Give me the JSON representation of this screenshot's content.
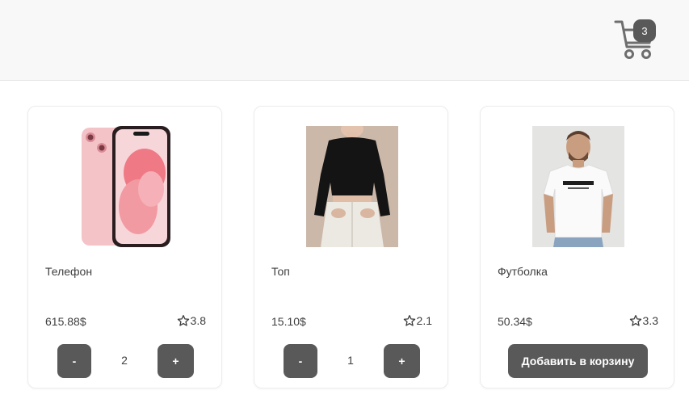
{
  "header": {
    "cart_count": "3"
  },
  "products": [
    {
      "name": "Телефон",
      "price": "615.88$",
      "rating": "3.8",
      "quantity": "2",
      "minus_label": "-",
      "plus_label": "+"
    },
    {
      "name": "Топ",
      "price": "15.10$",
      "rating": "2.1",
      "quantity": "1",
      "minus_label": "-",
      "plus_label": "+"
    },
    {
      "name": "Футболка",
      "price": "50.34$",
      "rating": "3.3",
      "add_label": "Добавить в корзину"
    }
  ],
  "colors": {
    "button": "#595959",
    "header_bg": "#f8f8f8",
    "badge": "#595959"
  },
  "icons": {
    "cart": "shopping-cart-icon",
    "rating": "star-outline-icon"
  }
}
